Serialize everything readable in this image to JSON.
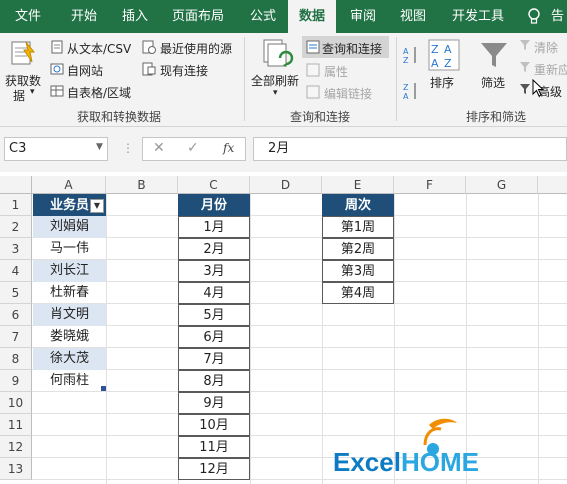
{
  "tabs": [
    "文件",
    "开始",
    "插入",
    "页面布局",
    "公式",
    "数据",
    "审阅",
    "视图",
    "开发工具"
  ],
  "tell_me": "告",
  "ribbon": {
    "get_data": [
      "获取数",
      "据"
    ],
    "from_text_csv": "从文本/CSV",
    "from_web": "自网站",
    "from_table": "自表格/区域",
    "recent_sources": "最近使用的源",
    "existing_connections": "现有连接",
    "refresh_all": "全部刷新",
    "queries_connections": "查询和连接",
    "properties": "属性",
    "edit_links": "编辑链接",
    "sort": "排序",
    "filter": "筛选",
    "clear": "清除",
    "reapply": "重新应",
    "advanced": "高级",
    "group_get_transform": "获取和转换数据",
    "group_queries": "查询和连接",
    "group_sort_filter": "排序和筛选"
  },
  "formula_bar": {
    "name_box": "C3",
    "formula": "2月",
    "fx": "fx"
  },
  "columns": [
    "A",
    "B",
    "C",
    "D",
    "E",
    "F",
    "G"
  ],
  "rows": [
    "1",
    "2",
    "3",
    "4",
    "5",
    "6",
    "7",
    "8",
    "9",
    "10",
    "11",
    "12",
    "13"
  ],
  "col_a": {
    "header": "业务员",
    "values": [
      "刘娟娟",
      "马一伟",
      "刘长江",
      "杜新春",
      "肖文明",
      "娄晓娥",
      "徐大茂",
      "何雨柱"
    ]
  },
  "col_c": {
    "header": "月份",
    "values": [
      "1月",
      "2月",
      "3月",
      "4月",
      "5月",
      "6月",
      "7月",
      "8月",
      "9月",
      "10月",
      "11月",
      "12月"
    ]
  },
  "col_e": {
    "header": "周次",
    "values": [
      "第1周",
      "第2周",
      "第3周",
      "第4周"
    ]
  },
  "logo": {
    "text_dark": "Excel",
    "text_light": "HOME"
  },
  "colors": {
    "excel_green": "#217346",
    "header_fill": "#1f4e79",
    "shaded_fill": "#dce6f2"
  }
}
